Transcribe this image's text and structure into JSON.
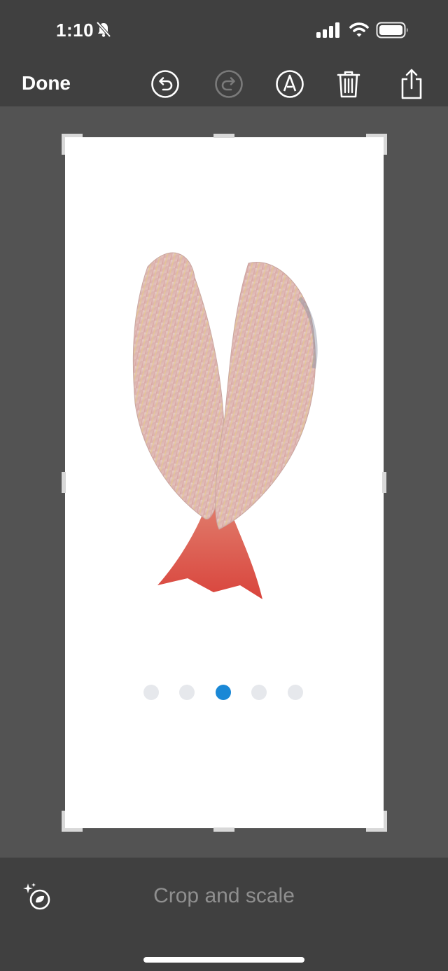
{
  "status_bar": {
    "time": "1:10"
  },
  "toolbar": {
    "done_label": "Done",
    "icons": [
      "undo-icon",
      "redo-icon",
      "markup-icon",
      "trash-icon",
      "share-icon"
    ]
  },
  "pagination": {
    "count": 5,
    "active_index": 2,
    "active_color": "#1a88d6",
    "inactive_color": "#e6e8ec"
  },
  "bottom_bar": {
    "title": "Crop and scale",
    "left_icon": "auto-enhance-icon"
  }
}
